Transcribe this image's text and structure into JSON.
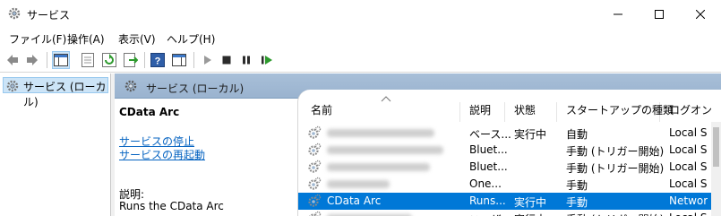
{
  "window": {
    "title": "サービス"
  },
  "menu": [
    "ファイル(F)",
    "操作(A)",
    "表示(V)",
    "ヘルプ(H)"
  ],
  "tree": {
    "item_label": "サービス (ローカル)"
  },
  "detail": {
    "header_title": "サービス (ローカル)",
    "service_name": "CData Arc",
    "stop_link": "サービスの停止",
    "restart_link": "サービスの再起動",
    "description_label": "説明:",
    "description_text": "Runs the CData Arc"
  },
  "columns": [
    "名前",
    "説明",
    "状態",
    "スタートアップの種類",
    "ログオン"
  ],
  "rows": [
    {
      "name": "",
      "desc": "ベース...",
      "status": "実行中",
      "startup": "自動",
      "logon": "Local S",
      "selected": false
    },
    {
      "name": "",
      "desc": "Bluet...",
      "status": "",
      "startup": "手動 (トリガー開始)",
      "logon": "Local S",
      "selected": false
    },
    {
      "name": "",
      "desc": "Bluet...",
      "status": "",
      "startup": "手動 (トリガー開始)",
      "logon": "Local S",
      "selected": false
    },
    {
      "name": "",
      "desc": "One...",
      "status": "",
      "startup": "手動",
      "logon": "Local S",
      "selected": false
    },
    {
      "name": "CData Arc",
      "desc": "Runs...",
      "status": "実行中",
      "startup": "手動",
      "logon": "Networ",
      "selected": true
    },
    {
      "name": "",
      "desc": "ユーザ",
      "status": "実行中",
      "startup": "手動 (トリガー開始)",
      "logon": "Local S",
      "selected": false
    }
  ],
  "colors": {
    "selection": "#0078d7",
    "header_band": "#a8bfd8",
    "link": "#0563c1"
  }
}
